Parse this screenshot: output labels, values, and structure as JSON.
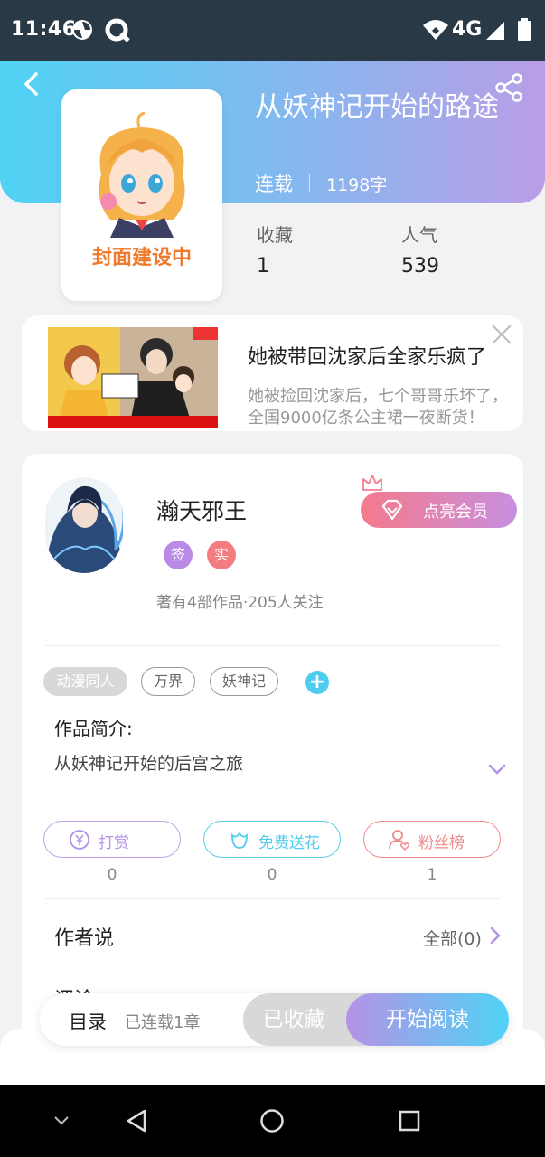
{
  "status_bar": {
    "time": "11:46",
    "network": "4G"
  },
  "book": {
    "title": "从妖神记开始的路途",
    "cover_label": "封面建设中",
    "status": "连载",
    "word_count": "1198字",
    "stats": [
      {
        "label": "收藏",
        "value": "1"
      },
      {
        "label": "人气",
        "value": "539"
      }
    ]
  },
  "ad": {
    "title": "她被带回沈家后全家乐疯了",
    "description_line1": "她被捡回沈家后，七个哥哥乐坏了，",
    "description_line2": "全国9000亿条公主裙一夜断货！"
  },
  "author": {
    "name": "瀚天邪王",
    "badges": [
      "签",
      "实"
    ],
    "meta": "著有4部作品·205人关注",
    "vip_label": "点亮会员"
  },
  "tags": [
    "动漫同人",
    "万界",
    "妖神记"
  ],
  "intro": {
    "label": "作品简介:",
    "text": "从妖神记开始的后宫之旅"
  },
  "actions": [
    {
      "label": "打赏",
      "count": "0"
    },
    {
      "label": "免费送花",
      "count": "0"
    },
    {
      "label": "粉丝榜",
      "count": "1"
    }
  ],
  "author_says": {
    "label": "作者说",
    "all_label": "全部(0)"
  },
  "comments_peek": "评论",
  "bottom_bar": {
    "toc_label": "目录",
    "toc_meta": "已连载1章",
    "favorited_label": "已收藏",
    "read_label": "开始阅读"
  },
  "colors": {
    "header_start": "#4fd3f5",
    "header_end": "#b99ee6",
    "cover_label": "#f07a2c",
    "accent_cyan": "#4fcdee",
    "accent_purple": "#b592e6",
    "vip_pink": "#f57a8c"
  },
  "icons": {
    "back": "chevron-left-icon",
    "share": "share-icon",
    "close": "close-icon",
    "diamond": "diamond-icon",
    "crown": "crown-icon",
    "coin": "yen-coin-icon",
    "flower": "flower-icon",
    "fans": "user-heart-icon",
    "expand": "chevron-down-icon"
  }
}
